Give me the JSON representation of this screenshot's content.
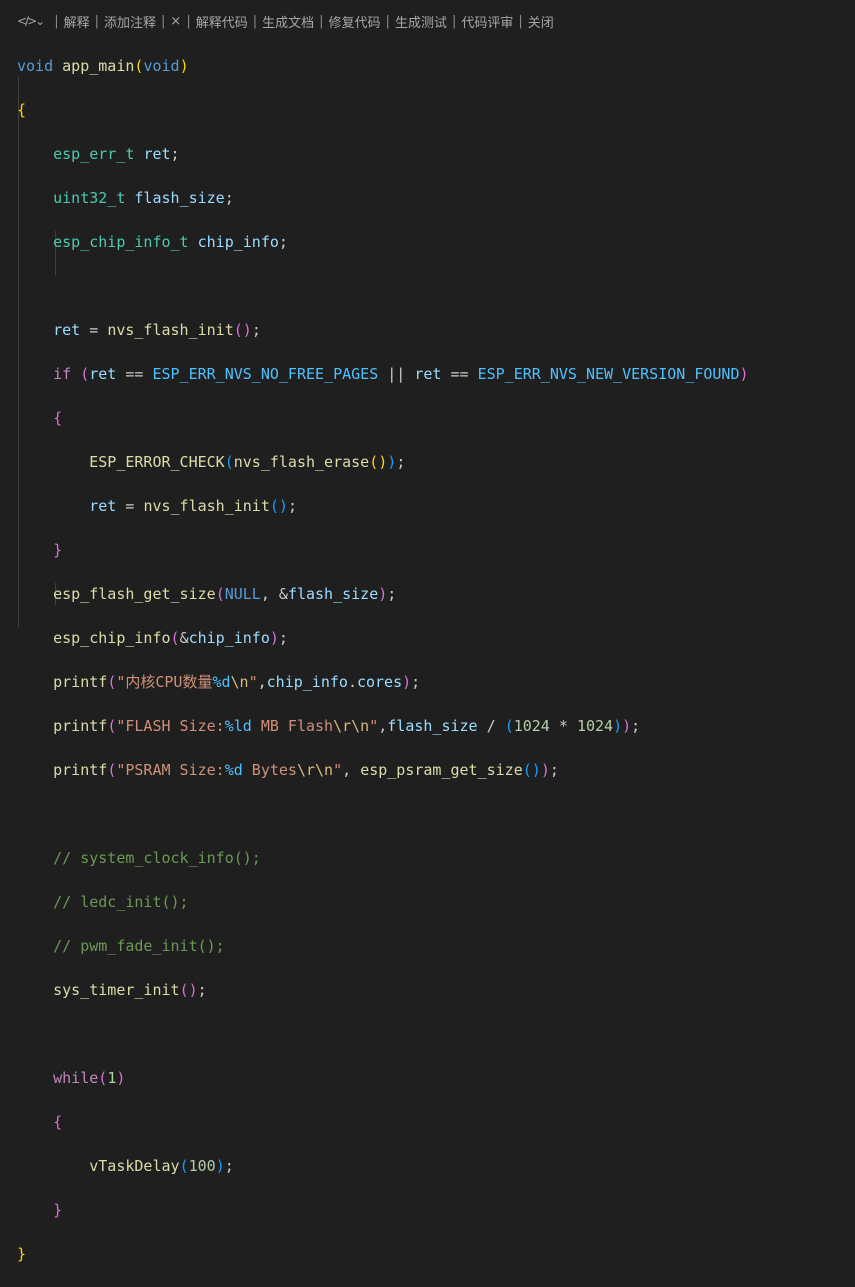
{
  "codelens": {
    "icon": "sparkle-chevron-icon",
    "items": [
      "解释",
      "添加注释",
      "×",
      "解释代码",
      "生成文档",
      "修复代码",
      "生成测试",
      "代码评审",
      "关闭"
    ]
  },
  "code": {
    "l1": [
      "void",
      "app_main",
      "(",
      "void",
      ")"
    ],
    "l2": [
      "{"
    ],
    "l3": [
      "esp_err_t",
      "ret",
      ";"
    ],
    "l4": [
      "uint32_t",
      "flash_size",
      ";"
    ],
    "l5": [
      "esp_chip_info_t",
      "chip_info",
      ";"
    ],
    "l7": [
      "ret",
      " = ",
      "nvs_flash_init",
      "(",
      ")",
      ";"
    ],
    "l8": [
      "if",
      " ",
      "(",
      "ret",
      " == ",
      "ESP_ERR_NVS_NO_FREE_PAGES",
      " || ",
      "ret",
      " == ",
      "ESP_ERR_NVS_NEW_VERSION_FOUND",
      ")"
    ],
    "l9": [
      "{"
    ],
    "l10": [
      "ESP_ERROR_CHECK",
      "(",
      "nvs_flash_erase",
      "(",
      ")",
      ")",
      ";"
    ],
    "l11": [
      "ret",
      " = ",
      "nvs_flash_init",
      "(",
      ")",
      ";"
    ],
    "l12": [
      "}"
    ],
    "l13": [
      "esp_flash_get_size",
      "(",
      "NULL",
      ", &",
      "flash_size",
      ")",
      ";"
    ],
    "l14": [
      "esp_chip_info",
      "(",
      "&",
      "chip_info",
      ")",
      ";"
    ],
    "l15": [
      "printf",
      "(",
      "\"内核CPU数量",
      "%d",
      "\\n",
      "\"",
      ",",
      "chip_info",
      ".",
      "cores",
      ")",
      ";"
    ],
    "l16": [
      "printf",
      "(",
      "\"FLASH Size:",
      "%ld",
      " MB Flash",
      "\\r\\n",
      "\"",
      ",",
      "flash_size",
      " / ",
      "(",
      "1024",
      " * ",
      "1024",
      ")",
      ")",
      ";"
    ],
    "l17": [
      "printf",
      "(",
      "\"PSRAM Size:",
      "%d",
      " Bytes",
      "\\r\\n",
      "\"",
      ", ",
      "esp_psram_get_size",
      "(",
      ")",
      ")",
      ";"
    ],
    "l19": [
      "// system_clock_info();"
    ],
    "l20": [
      "// ledc_init();"
    ],
    "l21": [
      "// pwm_fade_init();"
    ],
    "l22": [
      "sys_timer_init",
      "(",
      ")",
      ";"
    ],
    "l24": [
      "while",
      "(",
      "1",
      ")"
    ],
    "l25": [
      "{"
    ],
    "l26": [
      "vTaskDelay",
      "(",
      "100",
      ")",
      ";"
    ],
    "l27": [
      "}"
    ],
    "l28": [
      "}"
    ]
  }
}
